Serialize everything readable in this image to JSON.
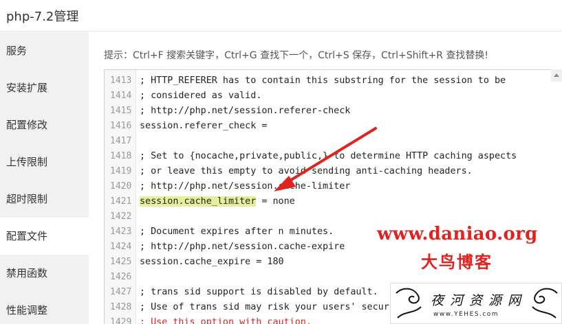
{
  "window": {
    "title": "php-7.2管理"
  },
  "sidebar": {
    "items": [
      {
        "label": "服务"
      },
      {
        "label": "安装扩展"
      },
      {
        "label": "配置修改"
      },
      {
        "label": "上传限制"
      },
      {
        "label": "超时限制"
      },
      {
        "label": "配置文件",
        "active": true
      },
      {
        "label": "禁用函数"
      },
      {
        "label": "性能调整"
      }
    ]
  },
  "hint": "提示：Ctrl+F 搜索关键字，Ctrl+G 查找下一个，Ctrl+S 保存，Ctrl+Shift+R 查找替换!",
  "editor": {
    "lines": [
      {
        "n": "1413",
        "text": "; HTTP_REFERER has to contain this substring for the session to be"
      },
      {
        "n": "1414",
        "text": "; considered as valid."
      },
      {
        "n": "1415",
        "text": "; http://php.net/session.referer-check"
      },
      {
        "n": "1416",
        "text": "session.referer_check ="
      },
      {
        "n": "1417",
        "text": ""
      },
      {
        "n": "1418",
        "text": "; Set to {nocache,private,public,} to determine HTTP caching aspects"
      },
      {
        "n": "1419",
        "text": "; or leave this empty to avoid sending anti-caching headers."
      },
      {
        "n": "1420",
        "text": "; http://php.net/session.cache-limiter"
      },
      {
        "n": "1421",
        "highlight": "session.cache_limiter",
        "rest": " = none"
      },
      {
        "n": "1422",
        "text": ""
      },
      {
        "n": "1423",
        "text": "; Document expires after n minutes."
      },
      {
        "n": "1424",
        "text": "; http://php.net/session.cache-expire"
      },
      {
        "n": "1425",
        "text": "session.cache_expire = 180"
      },
      {
        "n": "1426",
        "text": ""
      },
      {
        "n": "1427",
        "text": "; trans sid support is disabled by default."
      },
      {
        "n": "1428",
        "text": "; Use of trans sid may risk your users' security."
      },
      {
        "n": "1429",
        "text": "; Use this option with caution.",
        "red": true
      }
    ]
  },
  "watermark": {
    "site": "www.daniao.org",
    "name": "大鸟博客"
  },
  "logo": {
    "cn": "夜河资源网",
    "url": "www.YEHES.com"
  },
  "colors": {
    "accent_red": "#e0231f",
    "highlight": "#e7ee9a",
    "sidebar_bg": "#f1f1f1"
  }
}
